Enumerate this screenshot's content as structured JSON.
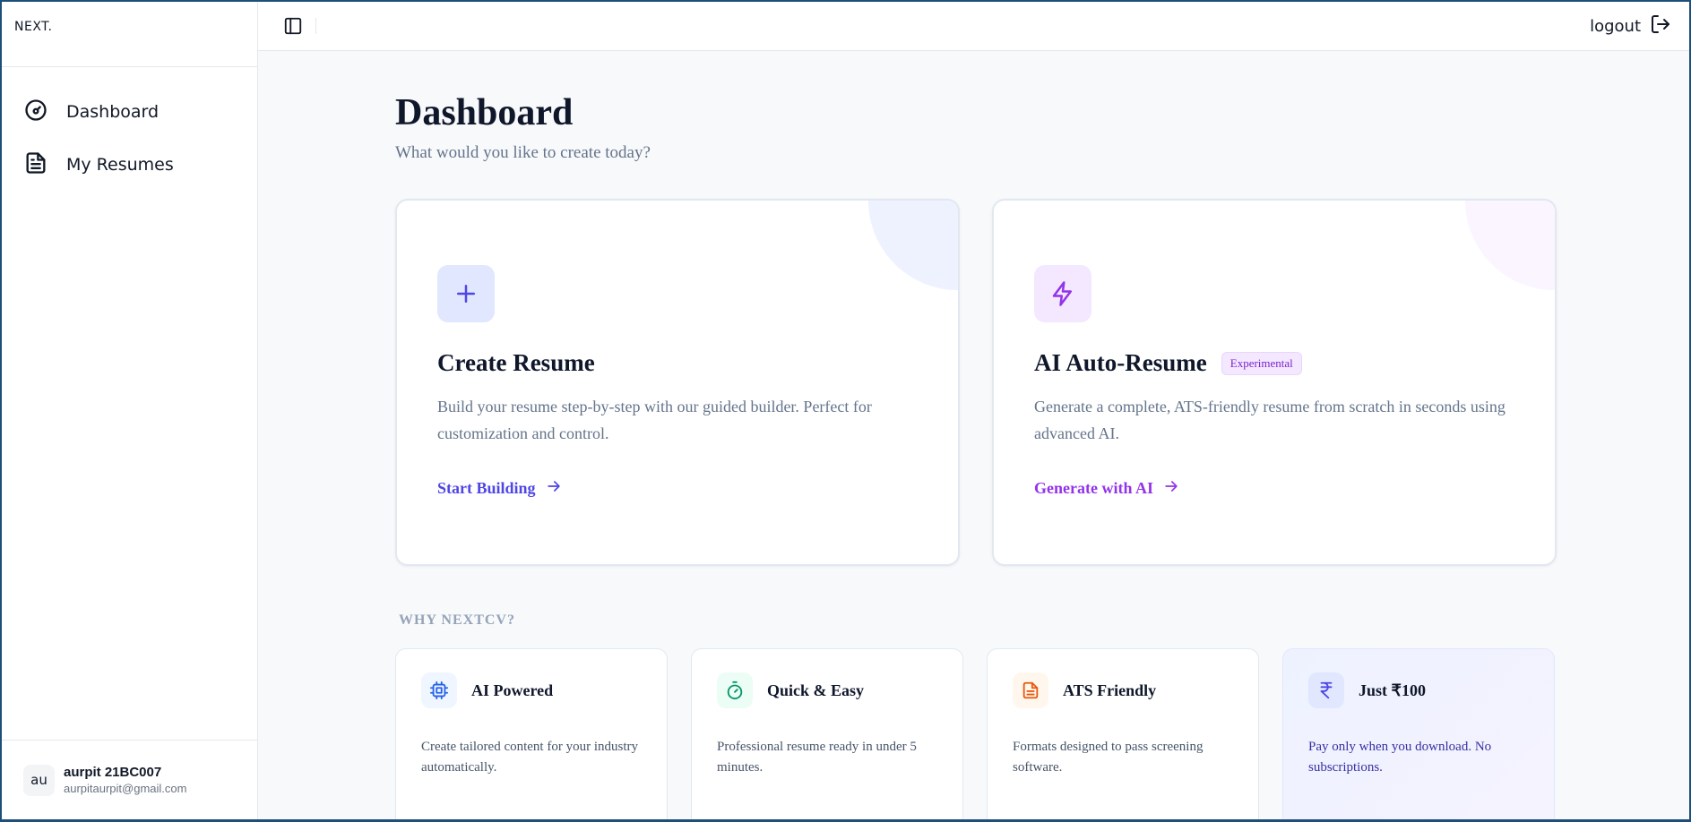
{
  "sidebar": {
    "logo": "NEXT.",
    "items": [
      {
        "label": "Dashboard",
        "icon": "gauge-icon"
      },
      {
        "label": "My Resumes",
        "icon": "file-text-icon"
      }
    ],
    "user": {
      "initials": "au",
      "name": "aurpit 21BC007",
      "email": "aurpitaurpit@gmail.com"
    }
  },
  "topbar": {
    "logout_label": "logout"
  },
  "main": {
    "title": "Dashboard",
    "subtitle": "What would you like to create today?",
    "cards": [
      {
        "title": "Create Resume",
        "description": "Build your resume step-by-step with our guided builder. Perfect for customization and control.",
        "link": "Start Building",
        "icon": "plus-icon",
        "accent": "#4f46e5"
      },
      {
        "title": "AI Auto-Resume",
        "badge": "Experimental",
        "description": "Generate a complete, ATS-friendly resume from scratch in seconds using advanced AI.",
        "link": "Generate with AI",
        "icon": "zap-icon",
        "accent": "#9333ea"
      }
    ],
    "section_label": "WHY NEXTCV?",
    "features": [
      {
        "title": "AI Powered",
        "description": "Create tailored content for your industry automatically.",
        "icon": "cpu-icon",
        "color": "#2563eb"
      },
      {
        "title": "Quick & Easy",
        "description": "Professional resume ready in under 5 minutes.",
        "icon": "timer-icon",
        "color": "#059669"
      },
      {
        "title": "ATS Friendly",
        "description": "Formats designed to pass screening software.",
        "icon": "file-icon",
        "color": "#ea580c"
      },
      {
        "title": "Just ₹100",
        "description": "Pay only when you download. No subscriptions.",
        "icon": "rupee-icon",
        "color": "#4f46e5"
      }
    ]
  }
}
